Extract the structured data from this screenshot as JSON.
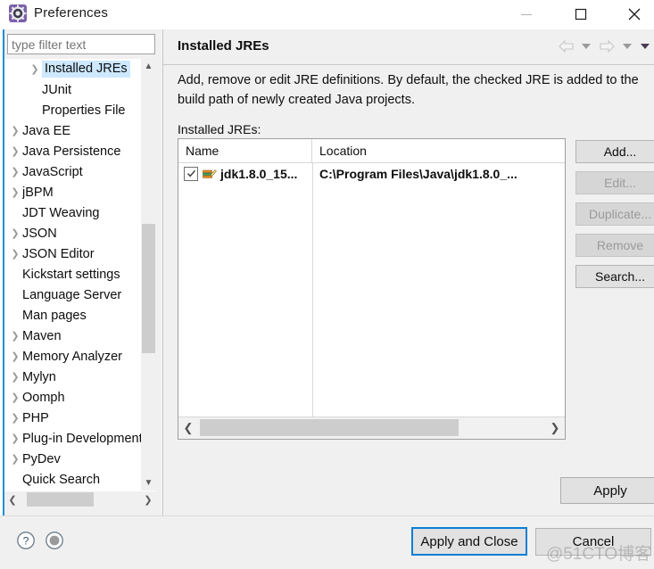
{
  "window": {
    "title": "Preferences",
    "icon": "preferences-gear-icon",
    "controls": {
      "minimize": "minimize-icon",
      "maximize": "maximize-icon",
      "close": "close-icon"
    }
  },
  "sidebar": {
    "filter": {
      "placeholder": "type filter text",
      "value": ""
    },
    "items": [
      {
        "label": "Installed JREs",
        "depth": 1,
        "expandable": true,
        "selected": true
      },
      {
        "label": "JUnit",
        "depth": 1,
        "expandable": false,
        "selected": false
      },
      {
        "label": "Properties File",
        "depth": 1,
        "expandable": false,
        "selected": false
      },
      {
        "label": "Java EE",
        "depth": 0,
        "expandable": true,
        "selected": false
      },
      {
        "label": "Java Persistence",
        "depth": 0,
        "expandable": true,
        "selected": false
      },
      {
        "label": "JavaScript",
        "depth": 0,
        "expandable": true,
        "selected": false
      },
      {
        "label": "jBPM",
        "depth": 0,
        "expandable": true,
        "selected": false
      },
      {
        "label": "JDT Weaving",
        "depth": 0,
        "expandable": false,
        "selected": false
      },
      {
        "label": "JSON",
        "depth": 0,
        "expandable": true,
        "selected": false
      },
      {
        "label": "JSON Editor",
        "depth": 0,
        "expandable": true,
        "selected": false
      },
      {
        "label": "Kickstart settings",
        "depth": 0,
        "expandable": false,
        "selected": false
      },
      {
        "label": "Language Server",
        "depth": 0,
        "expandable": false,
        "selected": false
      },
      {
        "label": "Man pages",
        "depth": 0,
        "expandable": false,
        "selected": false
      },
      {
        "label": "Maven",
        "depth": 0,
        "expandable": true,
        "selected": false
      },
      {
        "label": "Memory Analyzer",
        "depth": 0,
        "expandable": true,
        "selected": false
      },
      {
        "label": "Mylyn",
        "depth": 0,
        "expandable": true,
        "selected": false
      },
      {
        "label": "Oomph",
        "depth": 0,
        "expandable": true,
        "selected": false
      },
      {
        "label": "PHP",
        "depth": 0,
        "expandable": true,
        "selected": false
      },
      {
        "label": "Plug-in Development",
        "depth": 0,
        "expandable": true,
        "selected": false
      },
      {
        "label": "PyDev",
        "depth": 0,
        "expandable": true,
        "selected": false
      },
      {
        "label": "Quick Search",
        "depth": 0,
        "expandable": false,
        "selected": false
      }
    ]
  },
  "panel": {
    "title": "Installed JREs",
    "description": "Add, remove or edit JRE definitions. By default, the checked JRE is added to the build path of newly created Java projects.",
    "list_label": "Installed JREs:",
    "nav": {
      "back": "back-arrow-icon",
      "back_menu": "chevron-down-icon",
      "forward": "forward-arrow-icon",
      "forward_menu": "chevron-down-icon",
      "view_menu": "chevron-down-icon"
    }
  },
  "table": {
    "columns": [
      "Name",
      "Location"
    ],
    "rows": [
      {
        "checked": true,
        "icon": "jre-library-icon",
        "name": "jdk1.8.0_15...",
        "location": "C:\\Program Files\\Java\\jdk1.8.0_..."
      }
    ],
    "hscroll": {
      "left": "scroll-left-icon",
      "right": "scroll-right-icon"
    }
  },
  "side_buttons": [
    {
      "label": "Add...",
      "enabled": true
    },
    {
      "label": "Edit...",
      "enabled": false
    },
    {
      "label": "Duplicate...",
      "enabled": false
    },
    {
      "label": "Remove",
      "enabled": false
    },
    {
      "label": "Search...",
      "enabled": true
    }
  ],
  "apply_button": {
    "label": "Apply"
  },
  "footer": {
    "help_icon": "help-question-icon",
    "disclosure_icon": "filled-circle-icon",
    "apply_and_close": "Apply and Close",
    "cancel": "Cancel",
    "watermark": "@51CTO博客"
  },
  "colors": {
    "accent_blue": "#0a7fd6",
    "selection_blue": "#cde8ff",
    "button_face": "#e1e1e1",
    "panel_bg": "#f0f0f0"
  }
}
